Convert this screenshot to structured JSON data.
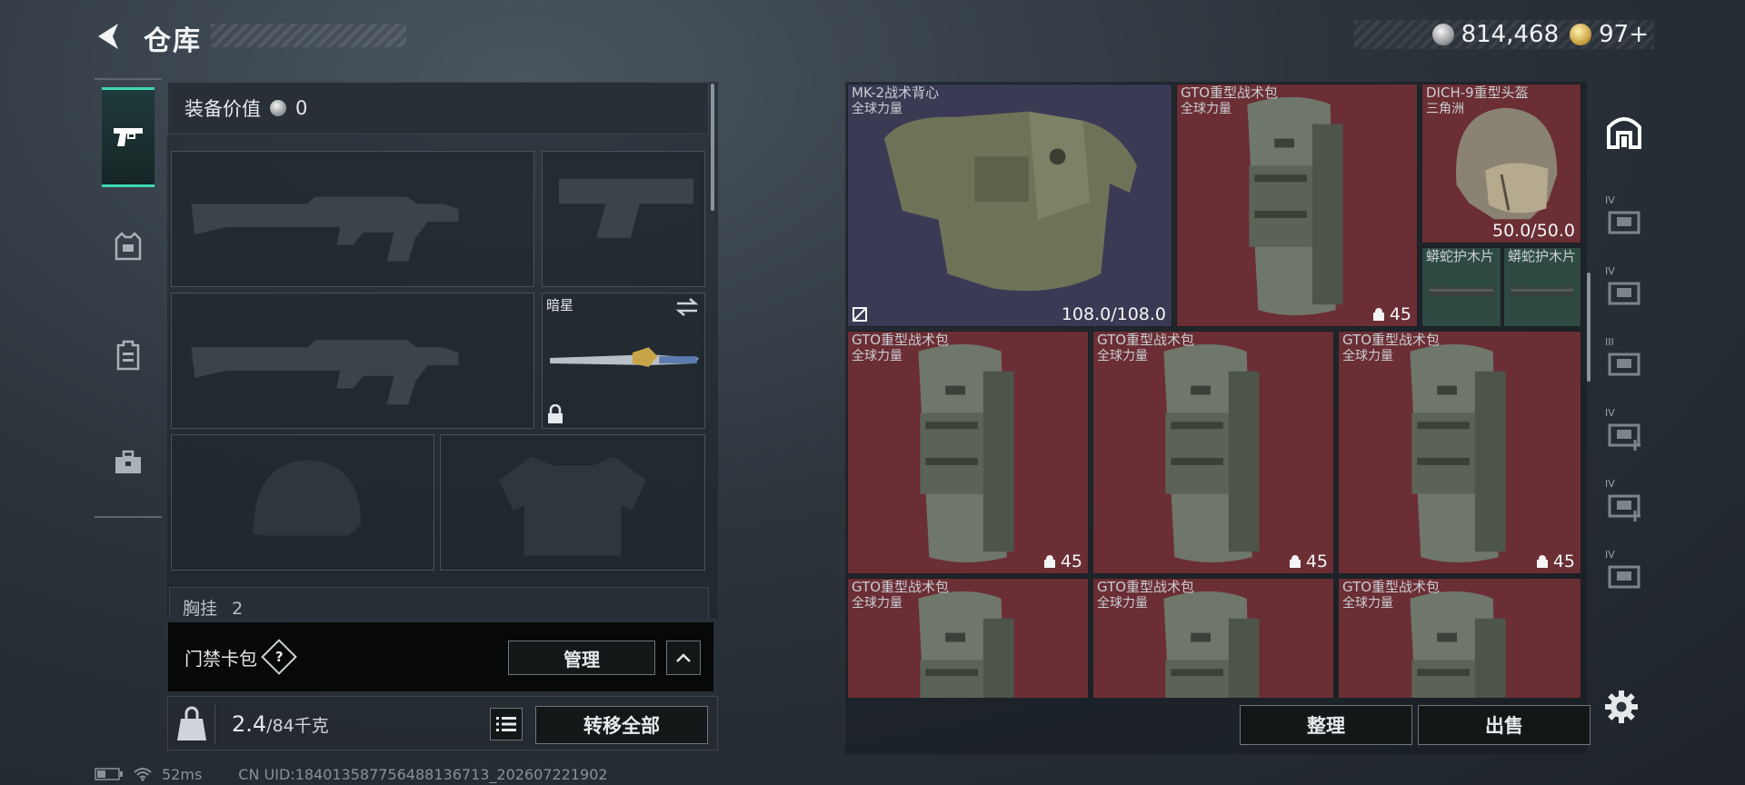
{
  "header": {
    "title": "仓库",
    "currencies": [
      {
        "icon": "silver-coin-icon",
        "value": "814,468"
      },
      {
        "icon": "gold-coin-icon",
        "value": "97+"
      }
    ]
  },
  "category_tabs": [
    {
      "icon": "pistol-icon",
      "active": true
    },
    {
      "icon": "armor-vest-icon",
      "active": false
    },
    {
      "icon": "backpack-icon",
      "active": false
    },
    {
      "icon": "toolbox-icon",
      "active": false
    }
  ],
  "equipment": {
    "value_label": "装备价值",
    "value": "0",
    "melee_slot": {
      "name": "暗星"
    },
    "chest_rig_label": "胸挂",
    "chest_rig_count": "2"
  },
  "keycard": {
    "label": "门禁卡包",
    "help": "?",
    "manage_label": "管理"
  },
  "weight": {
    "current": "2.4",
    "max": "/84千克",
    "transfer_all_label": "转移全部"
  },
  "status": {
    "ping": "52ms",
    "uid": "CN UID:184013587756488136713_202607221902"
  },
  "inventory": {
    "items": [
      {
        "name": "MK-2战术背心",
        "sub": "全球力量",
        "value": "108.0/108.0",
        "color": "purple",
        "art": "vest"
      },
      {
        "name": "GTO重型战术包",
        "sub": "全球力量",
        "value": "45",
        "color": "red",
        "art": "pack"
      },
      {
        "name": "DICH-9重型头盔",
        "sub": "三角洲",
        "value": "50.0/50.0",
        "color": "red",
        "art": "helmet"
      },
      {
        "name": "蟒蛇护木片",
        "sub": "",
        "value": "",
        "color": "green",
        "art": "rail"
      },
      {
        "name": "蟒蛇护木片",
        "sub": "",
        "value": "",
        "color": "green",
        "art": "rail"
      },
      {
        "name": "GTO重型战术包",
        "sub": "全球力量",
        "value": "45",
        "color": "red",
        "art": "pack"
      },
      {
        "name": "GTO重型战术包",
        "sub": "全球力量",
        "value": "45",
        "color": "red",
        "art": "pack"
      },
      {
        "name": "GTO重型战术包",
        "sub": "全球力量",
        "value": "45",
        "color": "red",
        "art": "pack"
      },
      {
        "name": "GTO重型战术包",
        "sub": "全球力量",
        "value": "",
        "color": "red",
        "art": "pack"
      },
      {
        "name": "GTO重型战术包",
        "sub": "全球力量",
        "value": "",
        "color": "red",
        "art": "pack"
      },
      {
        "name": "GTO重型战术包",
        "sub": "全球力量",
        "value": "",
        "color": "red",
        "art": "pack"
      }
    ],
    "sort_label": "整理",
    "sell_label": "出售"
  },
  "storage_tabs": [
    {
      "icon": "home-storage-icon",
      "tier": ""
    },
    {
      "icon": "storage-case-icon",
      "tier": "IV"
    },
    {
      "icon": "storage-case-icon",
      "tier": "IV"
    },
    {
      "icon": "storage-case-icon",
      "tier": "III"
    },
    {
      "icon": "storage-add-icon",
      "tier": "IV"
    },
    {
      "icon": "storage-add-icon",
      "tier": "IV"
    },
    {
      "icon": "storage-case-icon",
      "tier": "IV"
    }
  ],
  "colors": {
    "accent": "#3fd7b4",
    "item_red": "#6b2e34",
    "item_purple": "#3b3a55",
    "item_green": "#2e4a43"
  }
}
